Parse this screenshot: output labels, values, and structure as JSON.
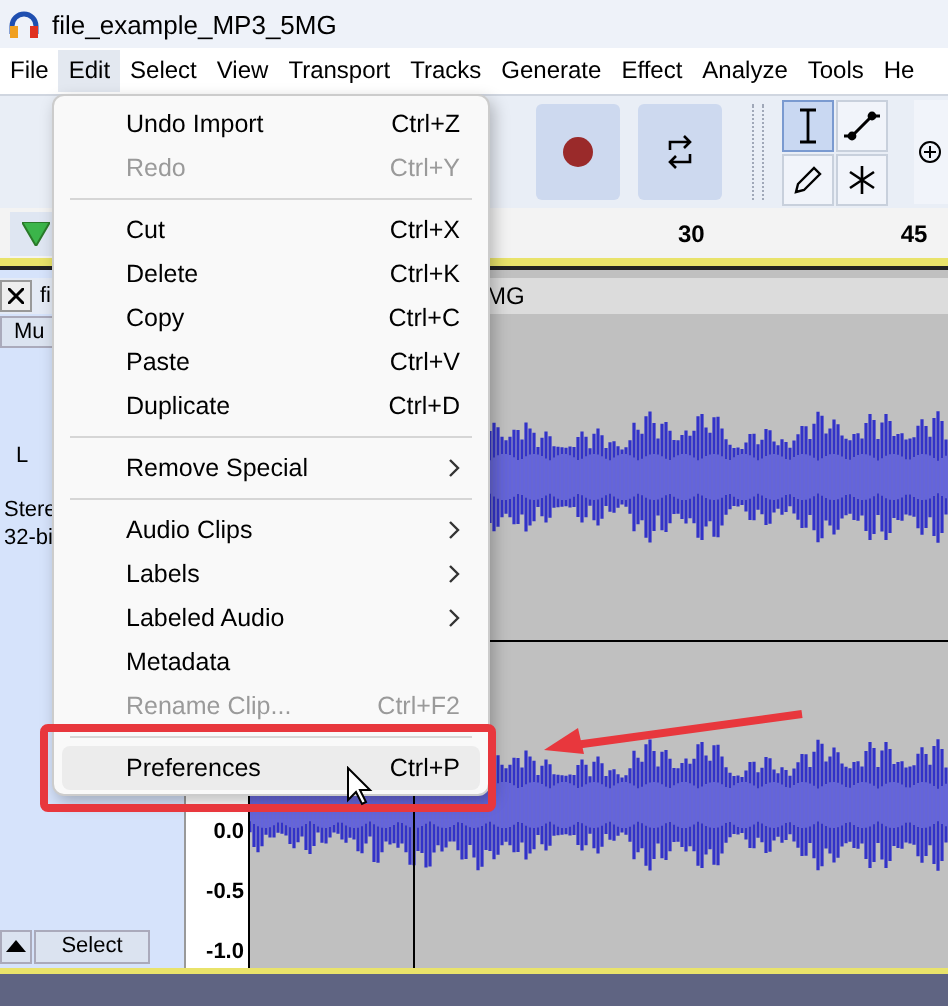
{
  "window": {
    "title": "file_example_MP3_5MG"
  },
  "menubar": [
    {
      "label": "File",
      "selected": false
    },
    {
      "label": "Edit",
      "selected": true
    },
    {
      "label": "Select",
      "selected": false
    },
    {
      "label": "View",
      "selected": false
    },
    {
      "label": "Transport",
      "selected": false
    },
    {
      "label": "Tracks",
      "selected": false
    },
    {
      "label": "Generate",
      "selected": false
    },
    {
      "label": "Effect",
      "selected": false
    },
    {
      "label": "Analyze",
      "selected": false
    },
    {
      "label": "Tools",
      "selected": false
    },
    {
      "label": "He",
      "selected": false
    }
  ],
  "tools": [
    {
      "kind": "ibeam",
      "selected": true
    },
    {
      "kind": "envelope",
      "selected": false
    },
    {
      "kind": "pencil",
      "selected": false
    },
    {
      "kind": "multi",
      "selected": false
    }
  ],
  "timeline": {
    "ticks": [
      "30",
      "45"
    ]
  },
  "track": {
    "title_start": "fi",
    "title_end": "MG",
    "mute_label": "Mu",
    "pan_label": "L",
    "info": [
      "Stere",
      "32-bi"
    ],
    "select_button": "Select",
    "scale": [
      "0.0",
      "-0.5",
      "-1.0"
    ]
  },
  "edit_menu": [
    {
      "kind": "item",
      "label": "Undo Import",
      "shortcut": "Ctrl+Z",
      "disabled": false,
      "submenu": false,
      "selected": false
    },
    {
      "kind": "item",
      "label": "Redo",
      "shortcut": "Ctrl+Y",
      "disabled": true,
      "submenu": false,
      "selected": false
    },
    {
      "kind": "separator"
    },
    {
      "kind": "item",
      "label": "Cut",
      "shortcut": "Ctrl+X",
      "disabled": false,
      "submenu": false,
      "selected": false
    },
    {
      "kind": "item",
      "label": "Delete",
      "shortcut": "Ctrl+K",
      "disabled": false,
      "submenu": false,
      "selected": false
    },
    {
      "kind": "item",
      "label": "Copy",
      "shortcut": "Ctrl+C",
      "disabled": false,
      "submenu": false,
      "selected": false
    },
    {
      "kind": "item",
      "label": "Paste",
      "shortcut": "Ctrl+V",
      "disabled": false,
      "submenu": false,
      "selected": false
    },
    {
      "kind": "item",
      "label": "Duplicate",
      "shortcut": "Ctrl+D",
      "disabled": false,
      "submenu": false,
      "selected": false
    },
    {
      "kind": "separator"
    },
    {
      "kind": "item",
      "label": "Remove Special",
      "disabled": false,
      "submenu": true,
      "selected": false
    },
    {
      "kind": "separator"
    },
    {
      "kind": "item",
      "label": "Audio Clips",
      "disabled": false,
      "submenu": true,
      "selected": false
    },
    {
      "kind": "item",
      "label": "Labels",
      "disabled": false,
      "submenu": true,
      "selected": false
    },
    {
      "kind": "item",
      "label": "Labeled Audio",
      "disabled": false,
      "submenu": true,
      "selected": false
    },
    {
      "kind": "item",
      "label": "Metadata",
      "disabled": false,
      "submenu": false,
      "selected": false
    },
    {
      "kind": "item",
      "label": "Rename Clip...",
      "shortcut": "Ctrl+F2",
      "disabled": true,
      "submenu": false,
      "selected": false
    },
    {
      "kind": "separator"
    },
    {
      "kind": "item",
      "label": "Preferences",
      "shortcut": "Ctrl+P",
      "disabled": false,
      "submenu": false,
      "selected": true
    }
  ]
}
